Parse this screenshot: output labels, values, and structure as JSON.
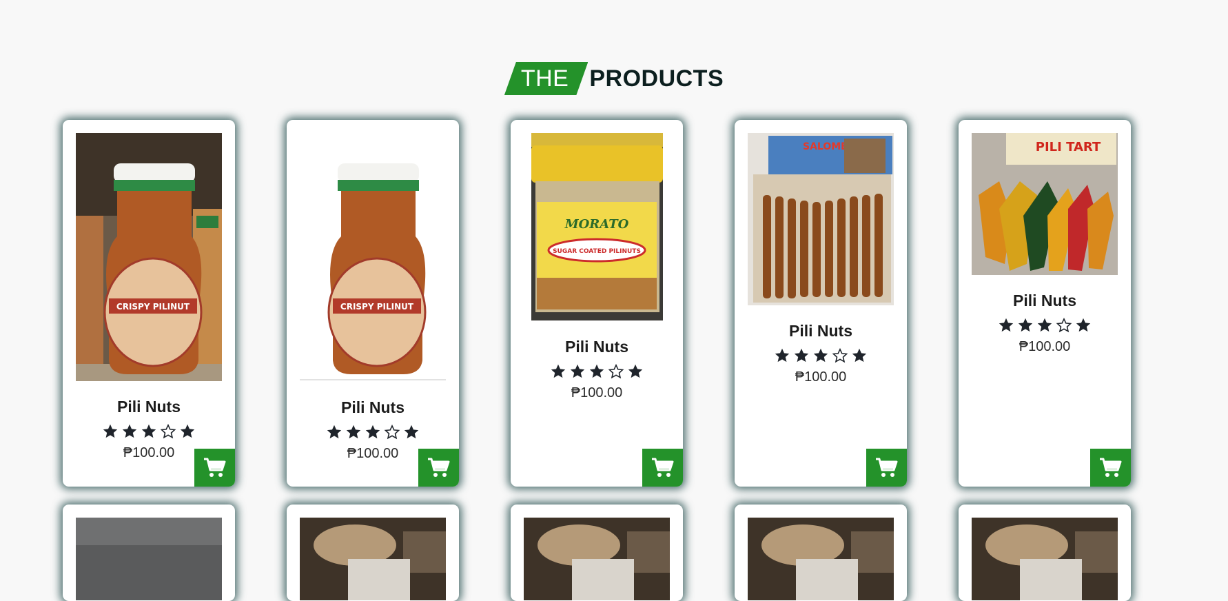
{
  "heading": {
    "prefix": "THE",
    "title": "PRODUCTS",
    "accent_color": "#24922a"
  },
  "products": [
    {
      "name": "Pili Nuts",
      "price": "₱100.00",
      "rating": 3,
      "icon": "cart-icon",
      "image": "crispy-pilinut-jar-shelf"
    },
    {
      "name": "Pili Nuts",
      "price": "₱100.00",
      "rating": 3,
      "icon": "cart-icon",
      "image": "crispy-pilinut-jar"
    },
    {
      "name": "Pili Nuts",
      "price": "₱100.00",
      "rating": 3,
      "icon": "cart-icon",
      "image": "sugar-coated-pilinuts-jar"
    },
    {
      "name": "Pili Nuts",
      "price": "₱100.00",
      "rating": 3,
      "icon": "cart-icon",
      "image": "salome-pinoy-roll-pack"
    },
    {
      "name": "Pili Nuts",
      "price": "₱100.00",
      "rating": 3,
      "icon": "cart-icon",
      "image": "pili-tart-pack"
    }
  ]
}
